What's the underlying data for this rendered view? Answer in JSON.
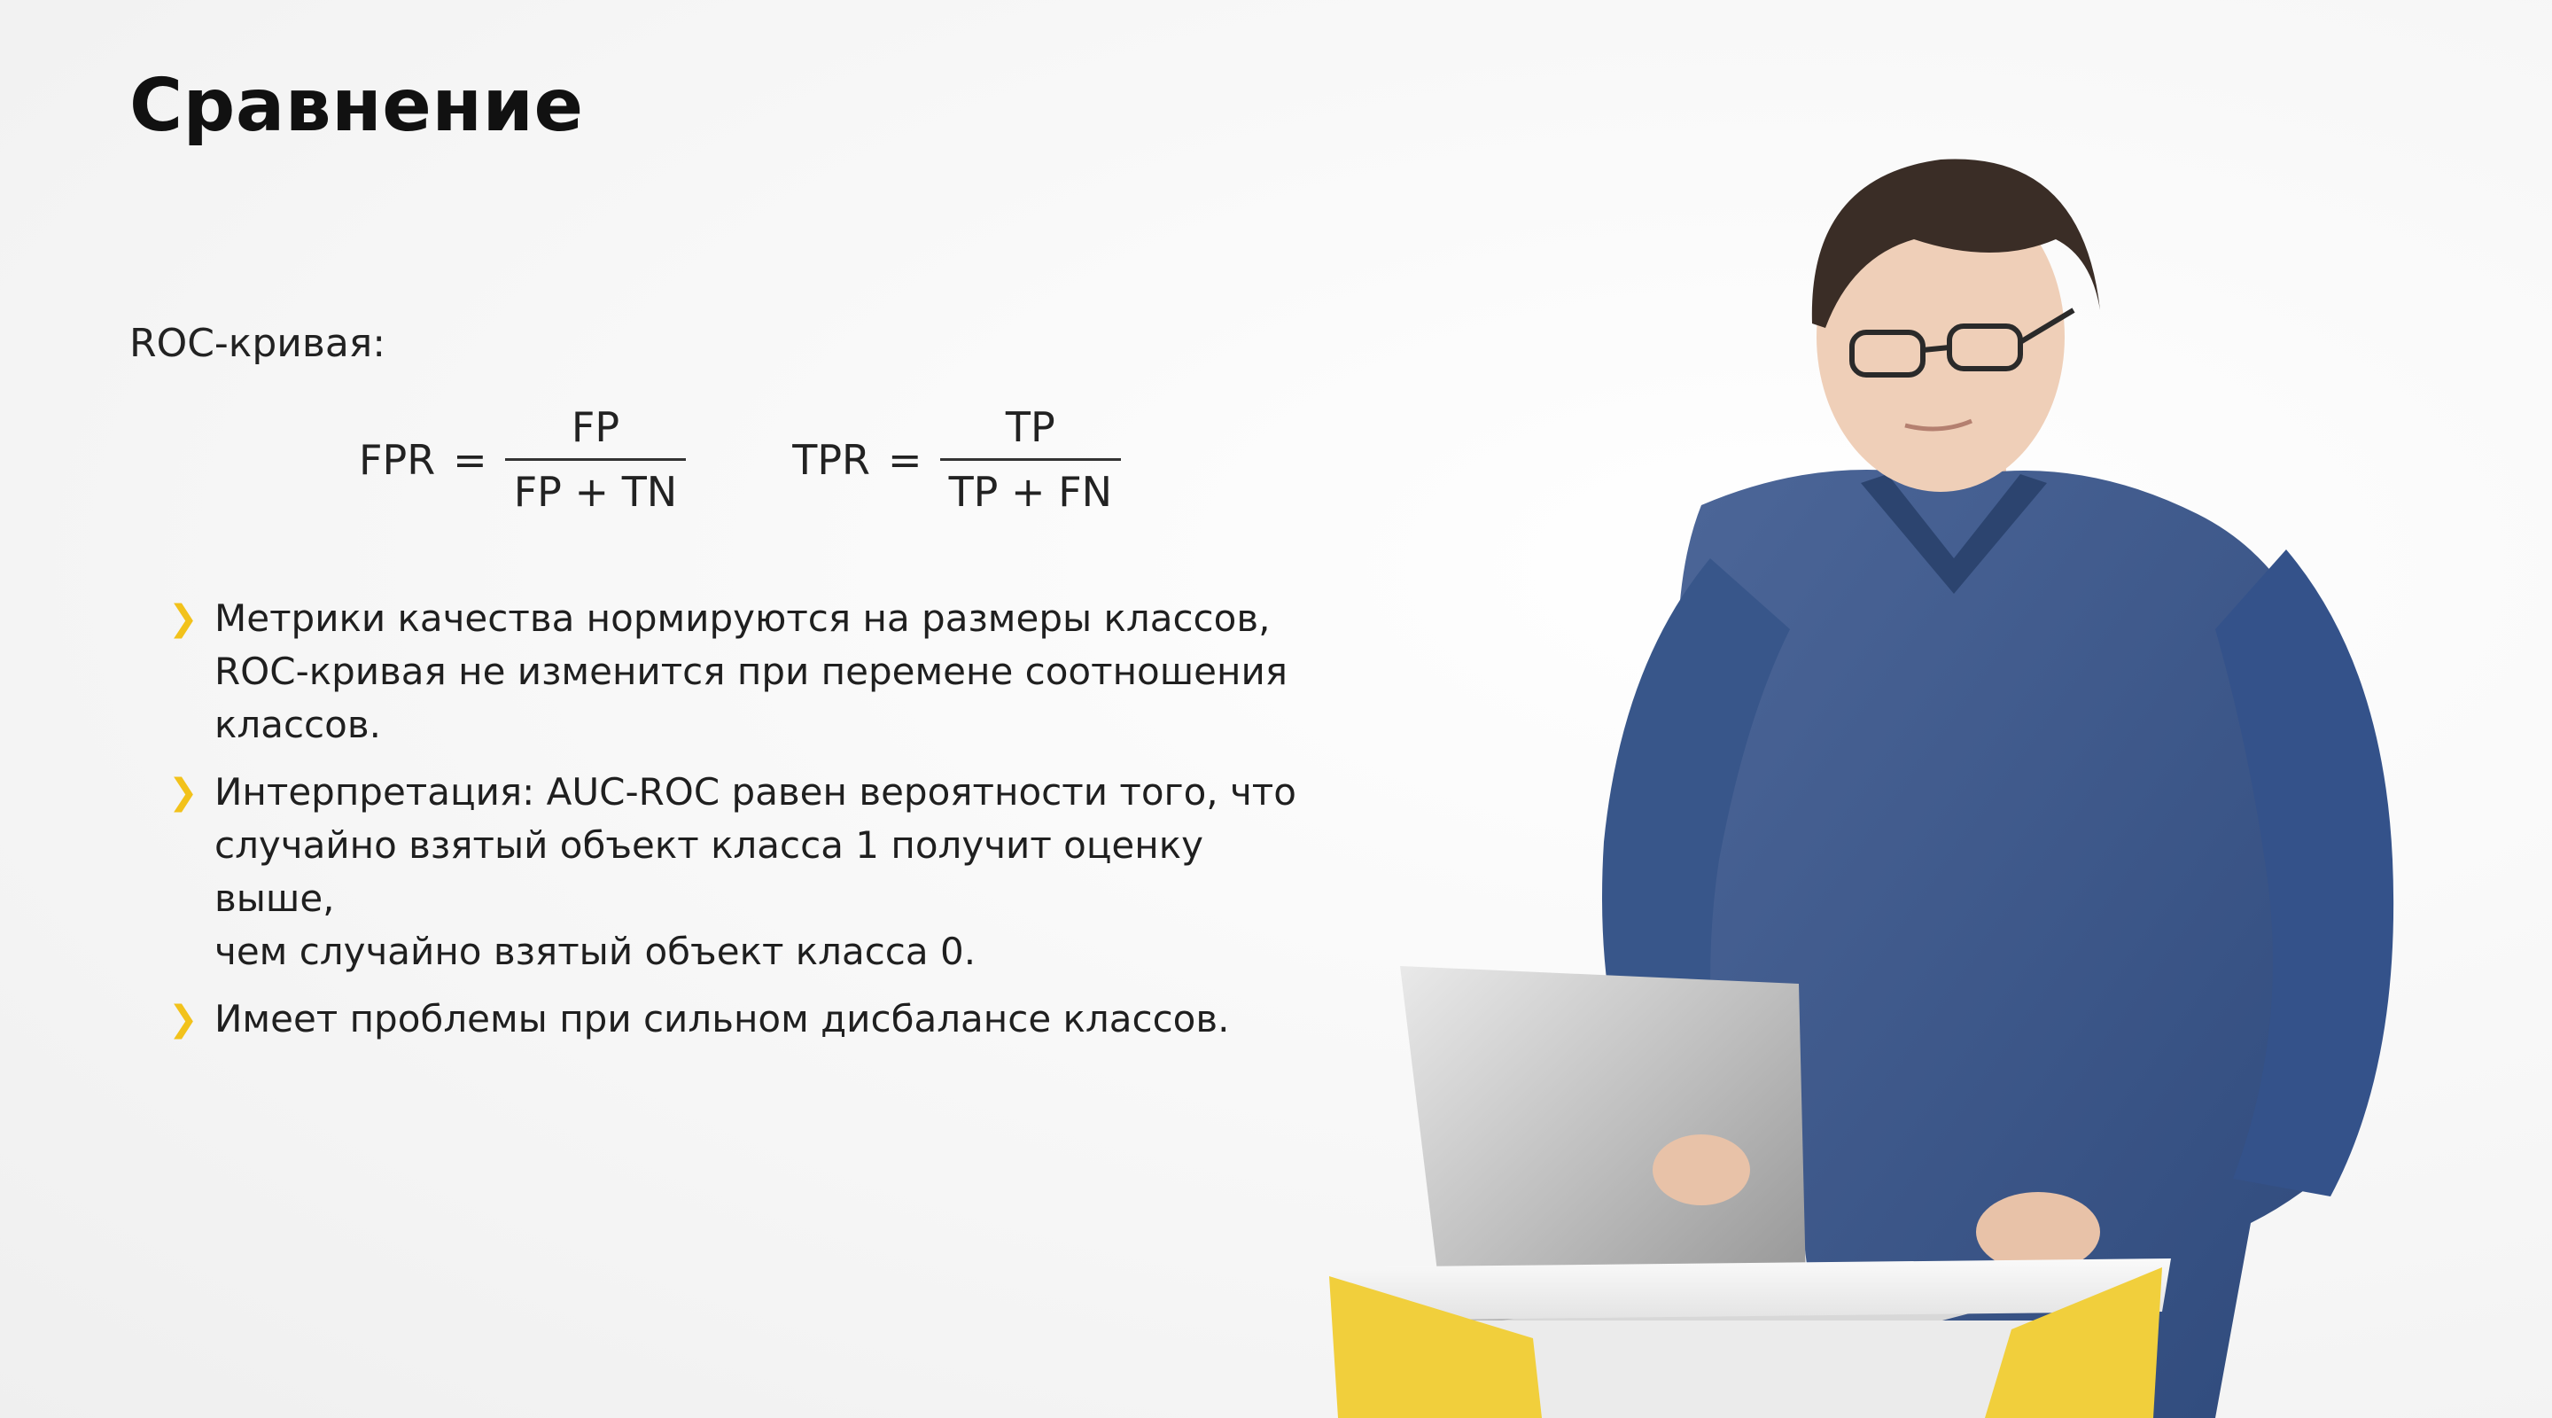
{
  "slide": {
    "title": "Сравнение",
    "subtitle": "ROC-кривая:",
    "formulas": [
      {
        "lhs": "FPR",
        "eq": "=",
        "num": "FP",
        "den": "FP + TN"
      },
      {
        "lhs": "TPR",
        "eq": "=",
        "num": "TP",
        "den": "TP + FN"
      }
    ],
    "bullet_icon": "❯",
    "bullets": [
      {
        "lines": [
          "Метрики качества нормируются на размеры классов,",
          "ROC-кривая не изменится при перемене соотношения",
          "классов."
        ]
      },
      {
        "lines": [
          "Интерпретация: AUC-ROC равен вероятности того, что",
          "случайно взятый объект класса 1 получит оценку выше,",
          "чем случайно взятый объект класса 0."
        ]
      },
      {
        "lines": [
          "Имеет проблемы при сильном дисбалансе классов."
        ]
      }
    ]
  },
  "colors": {
    "accent": "#f2c21b",
    "sweater": "#3a5588",
    "laptop": "#c9c9c9"
  },
  "icons": {
    "bullet": "chevron-right-icon"
  }
}
